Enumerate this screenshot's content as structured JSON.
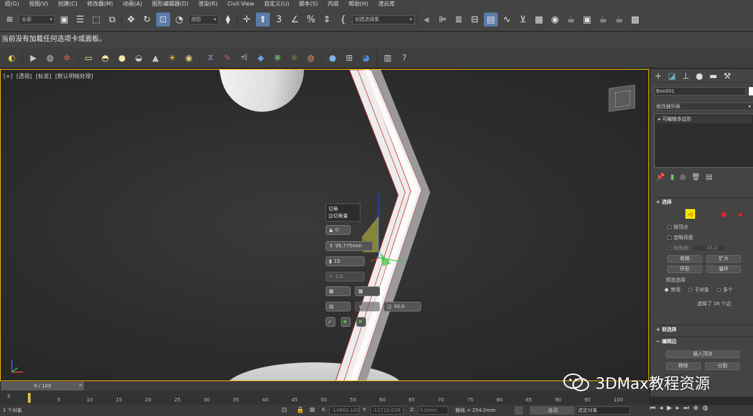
{
  "menu": {
    "items": [
      "组(G)",
      "视图(V)",
      "创建(C)",
      "修改器(M)",
      "动画(A)",
      "图形编辑器(D)",
      "渲染(R)",
      "Civil View",
      "自定义(U)",
      "脚本(S)",
      "内容",
      "帮助(H)",
      "渲云库"
    ]
  },
  "toolbar": {
    "filter_label": "全部",
    "refcoord_label": "视图",
    "selset_label": "创建选择集"
  },
  "message_bar": "当前没有加载任何选项卡或面板。",
  "viewport": {
    "label_plus": "[+]",
    "label_view": "[透视]",
    "label_shading": "[标准]",
    "label_lighting": "[默认明暗处理]",
    "caddy_title": "切角",
    "caddy_subtitle": "边切角量",
    "caddy_amount": "95.775mm",
    "caddy_segments": "15",
    "caddy_tension": "1.0",
    "caddy_angle": "30.0",
    "gizmo_axis": "Z"
  },
  "command_panel": {
    "object_name": "Box001",
    "modifier_list_label": "修改器列表",
    "stack_item": "可编辑多边形",
    "selection_rollout": "选择",
    "by_vertex": "按顶点",
    "ignore_backfacing": "忽略背面",
    "by_angle": "按角度:",
    "angle_value": "45.0",
    "shrink": "收缩",
    "grow": "扩大",
    "ring": "环形",
    "loop": "循环",
    "preview_selection": "预览选择",
    "disabled": "禁用",
    "subobject": "子对象",
    "multi": "多个",
    "selected_count": "选择了 16 个边",
    "soft_selection": "软选择",
    "edit_edges": "编辑边",
    "insert_vertex": "插入顶点",
    "remove": "移除",
    "split": "分割"
  },
  "timeline": {
    "slider": "0 / 100",
    "ticks": [
      "0",
      "5",
      "10",
      "15",
      "20",
      "25",
      "30",
      "35",
      "40",
      "45",
      "50",
      "55",
      "60",
      "65",
      "70",
      "75",
      "80",
      "85",
      "90",
      "95",
      "100"
    ]
  },
  "status": {
    "selected": "1 个对象",
    "x_label": "X:",
    "x_value": "-14883.102",
    "y_label": "Y:",
    "y_value": "-12715.028",
    "z_label": "Z:",
    "z_value": "0.0mm",
    "grid": "栅格 = 254.0mm",
    "auto": "自动",
    "selected_object": "选定对象"
  },
  "watermark": "3DMax教程资源",
  "colors": {
    "accent": "#5a7ca8",
    "viewport_border": "#f5b800",
    "selection_yellow": "#f2e300"
  }
}
